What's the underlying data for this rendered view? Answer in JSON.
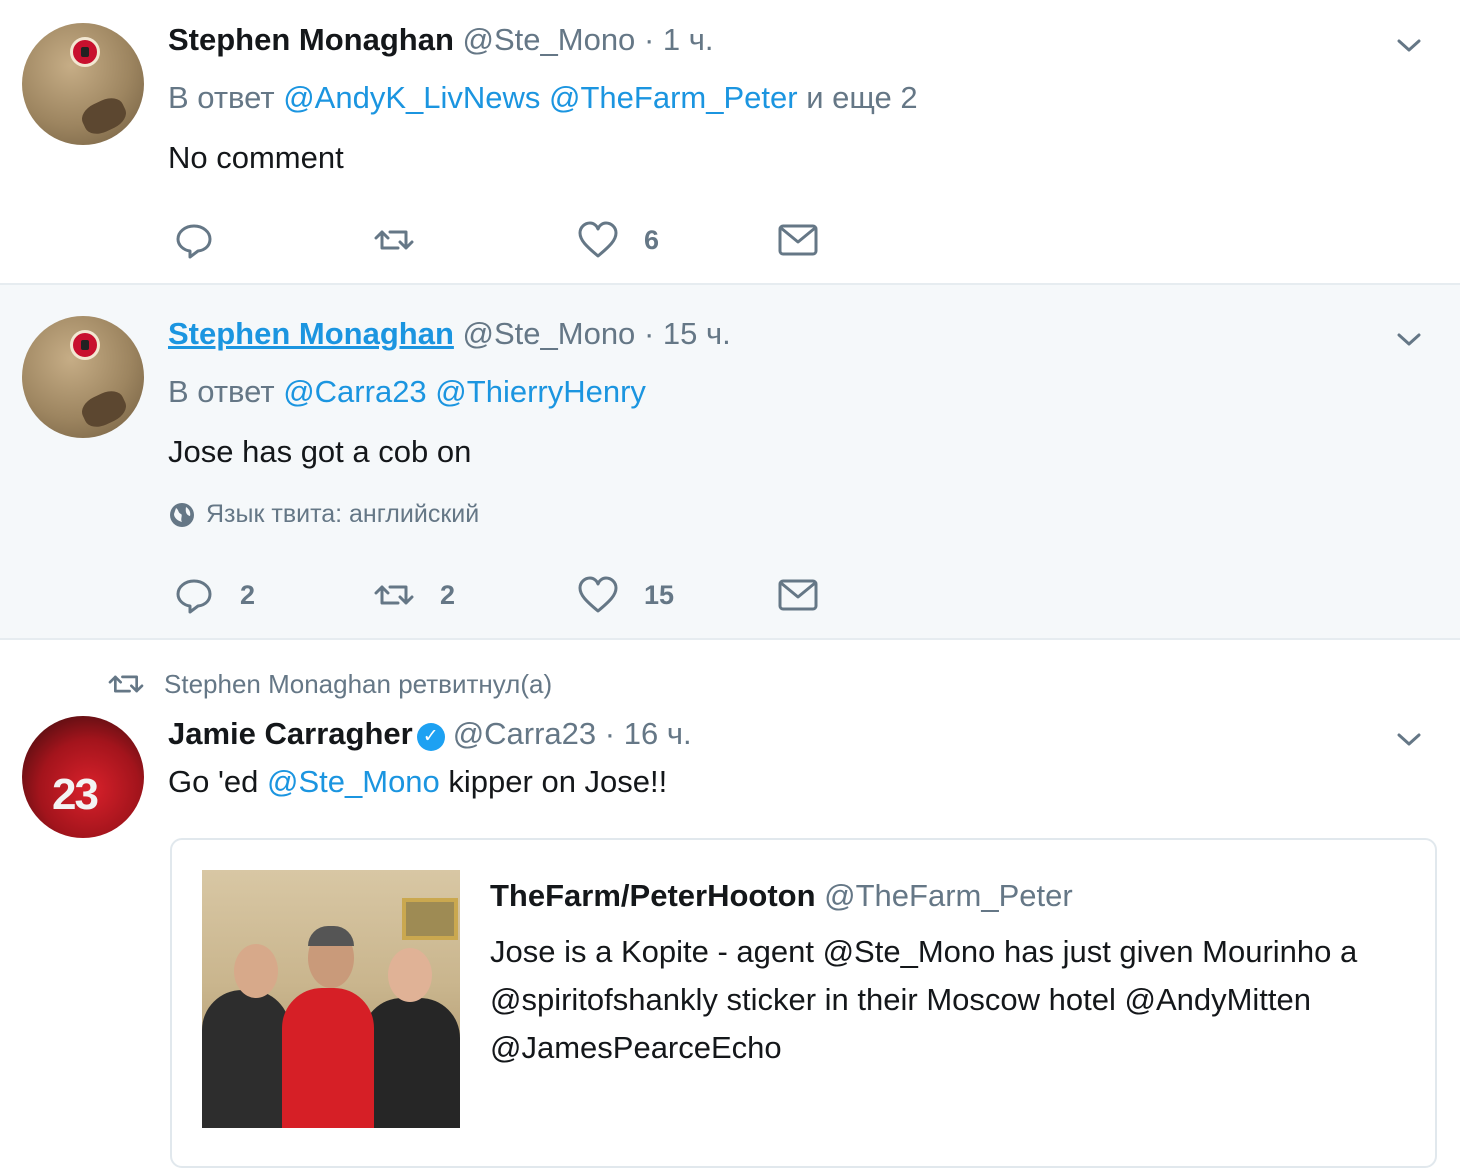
{
  "colors": {
    "link": "#1b95e0",
    "secondary": "#657786",
    "hover_bg": "#f5f8fa",
    "like": "#657786",
    "verified": "#1da1f2"
  },
  "tweet1": {
    "name": "Stephen Monaghan",
    "handle": "@Ste_Mono",
    "dot": "·",
    "time": "1 ч.",
    "reply_prefix": "В ответ",
    "reply_mentions": [
      "@AndyK_LivNews",
      "@TheFarm_Peter"
    ],
    "reply_suffix": "и еще 2",
    "text": "No comment",
    "like_count": "6"
  },
  "tweet2": {
    "name": "Stephen Monaghan",
    "handle": "@Ste_Mono",
    "dot": "·",
    "time": "15 ч.",
    "reply_prefix": "В ответ",
    "reply_mentions": [
      "@Carra23",
      "@ThierryHenry"
    ],
    "text": "Jose has got a cob on",
    "lang_label": "Язык твита: английский",
    "reply_count": "2",
    "retweet_count": "2",
    "like_count": "15"
  },
  "tweet3": {
    "retweeted_by": "Stephen Monaghan ретвитнул(а)",
    "name": "Jamie Carragher",
    "handle": "@Carra23",
    "dot": "·",
    "time": "16 ч.",
    "text_prefix": "Go 'ed",
    "text_mention": "@Ste_Mono",
    "text_suffix": "kipper on Jose!!",
    "avatar_number": "23",
    "verified_mark": "✓",
    "quote": {
      "name": "TheFarm/PeterHooton",
      "handle": "@TheFarm_Peter",
      "text": "Jose is a Kopite - agent  @Ste_Mono has just given Mourinho a @spiritofshankly sticker in their Moscow hotel @AndyMitten @JamesPearceEcho"
    }
  },
  "icons": {
    "chevron": "chevron-down-icon",
    "reply": "reply-icon",
    "retweet": "retweet-icon",
    "like": "heart-icon",
    "dm": "envelope-icon",
    "globe": "globe-icon"
  }
}
